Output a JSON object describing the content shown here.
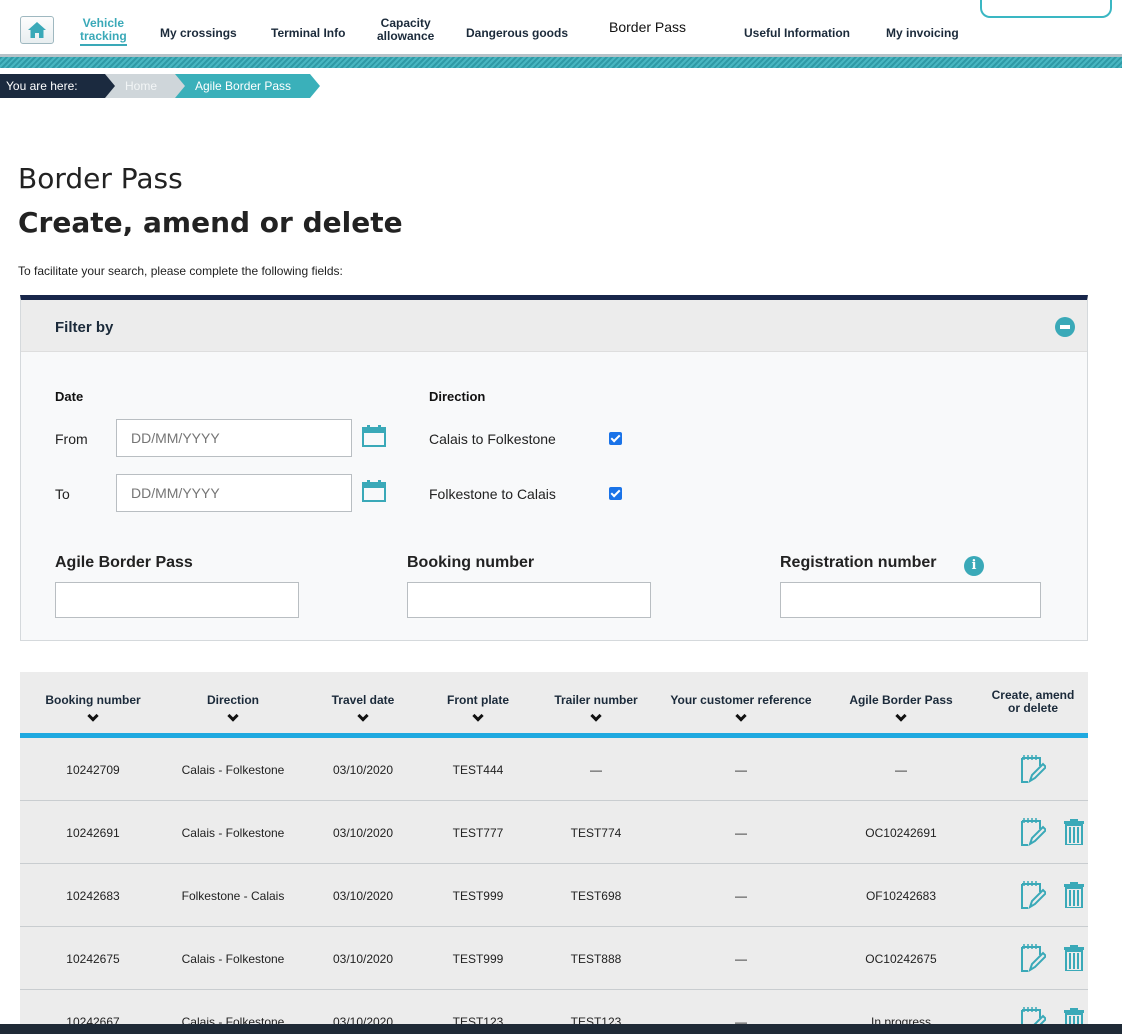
{
  "nav": {
    "home_icon": "home-icon",
    "items": [
      {
        "label": "Vehicle\ntracking",
        "active": true
      },
      {
        "label": "My crossings"
      },
      {
        "label": "Terminal Info"
      },
      {
        "label": "Capacity\nallowance"
      },
      {
        "label": "Dangerous goods"
      },
      {
        "label": "Border Pass"
      },
      {
        "label": "Useful Information"
      },
      {
        "label": "My invoicing"
      }
    ]
  },
  "breadcrumb": {
    "prefix": "You are here:",
    "home": "Home",
    "current": "Agile Border Pass"
  },
  "page": {
    "title": "Border Pass",
    "subtitle": "Create, amend or delete",
    "intro": "To facilitate your search, please complete the following fields:"
  },
  "filter": {
    "title": "Filter by",
    "date_label": "Date",
    "from_label": "From",
    "to_label": "To",
    "from_placeholder": "DD/MM/YYYY",
    "to_placeholder": "DD/MM/YYYY",
    "direction_label": "Direction",
    "directions": [
      {
        "label": "Calais to Folkestone",
        "checked": true
      },
      {
        "label": "Folkestone to Calais",
        "checked": true
      }
    ],
    "agile_label": "Agile Border Pass",
    "booking_label": "Booking number",
    "registration_label": "Registration number",
    "info_icon": "info-icon"
  },
  "table": {
    "headers": [
      "Booking number",
      "Direction",
      "Travel date",
      "Front plate",
      "Trailer number",
      "Your customer reference",
      "Agile Border Pass",
      "Create, amend\nor delete"
    ],
    "rows": [
      {
        "booking": "10242709",
        "direction": "Calais - Folkestone",
        "date": "03/10/2020",
        "front": "TEST444",
        "trailer": "—",
        "ref": "—",
        "pass": "—",
        "can_delete": false
      },
      {
        "booking": "10242691",
        "direction": "Calais - Folkestone",
        "date": "03/10/2020",
        "front": "TEST777",
        "trailer": "TEST774",
        "ref": "—",
        "pass": "OC10242691",
        "can_delete": true
      },
      {
        "booking": "10242683",
        "direction": "Folkestone - Calais",
        "date": "03/10/2020",
        "front": "TEST999",
        "trailer": "TEST698",
        "ref": "—",
        "pass": "OF10242683",
        "can_delete": true
      },
      {
        "booking": "10242675",
        "direction": "Calais - Folkestone",
        "date": "03/10/2020",
        "front": "TEST999",
        "trailer": "TEST888",
        "ref": "—",
        "pass": "OC10242675",
        "can_delete": true
      },
      {
        "booking": "10242667",
        "direction": "Calais - Folkestone",
        "date": "03/10/2020",
        "front": "TEST123",
        "trailer": "TEST123",
        "ref": "—",
        "pass": "In progress",
        "can_delete": true
      }
    ]
  },
  "colors": {
    "accent": "#3aa9b8",
    "navy": "#18264a",
    "table_rule": "#1fa9e0"
  }
}
